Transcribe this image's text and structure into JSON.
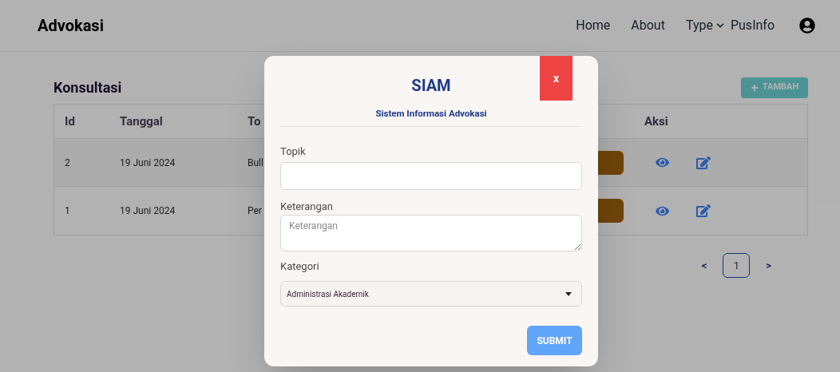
{
  "navbar": {
    "brand": "Advokasi",
    "links": [
      {
        "label": "Home",
        "kind": "link"
      },
      {
        "label": "About",
        "kind": "link"
      },
      {
        "label": "Type",
        "kind": "dropdown"
      },
      {
        "label": "PusInfo",
        "kind": "link"
      }
    ]
  },
  "page": {
    "title": "Konsultasi",
    "add_button": "TAMBAH"
  },
  "table": {
    "columns": [
      "Id",
      "Tanggal",
      "To",
      "Aksi"
    ],
    "rows": [
      {
        "id": "2",
        "tanggal": "19 Juni 2024",
        "topik": "Bull"
      },
      {
        "id": "1",
        "tanggal": "19 Juni 2024",
        "topik": "Per"
      }
    ]
  },
  "pagination": {
    "prev": "<",
    "pages": [
      {
        "label": "1",
        "selected": true
      }
    ],
    "next": ">"
  },
  "modal": {
    "title": "SIAM",
    "subtitle": "Sistem Informasi Advokasi",
    "close": "x",
    "fields": [
      {
        "label": "Topik",
        "kind": "input"
      },
      {
        "label": "Keterangan",
        "kind": "textarea",
        "placeholder": "Keterangan"
      },
      {
        "label": "Kategori",
        "kind": "select",
        "value": "Administrasi Akademik"
      }
    ],
    "submit": "SUBMIT"
  }
}
